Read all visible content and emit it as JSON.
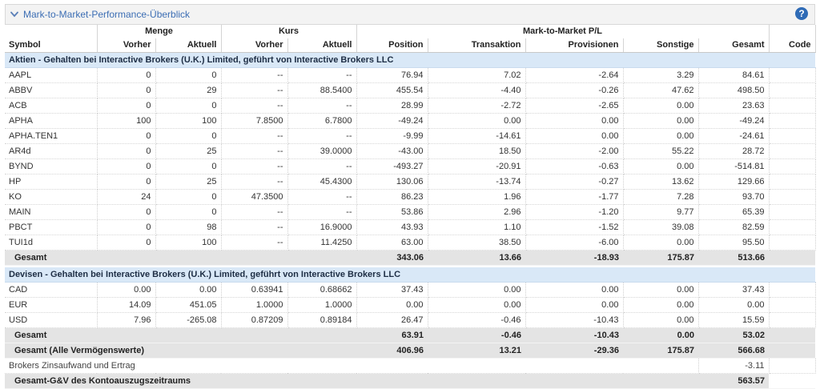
{
  "panel": {
    "title": "Mark-to-Market-Performance-Überblick",
    "help_glyph": "?"
  },
  "header": {
    "groups": {
      "menge": "Menge",
      "kurs": "Kurs",
      "mtm": "Mark-to-Market P/L"
    },
    "cols": [
      "Symbol",
      "Vorher",
      "Aktuell",
      "Vorher",
      "Aktuell",
      "Position",
      "Transaktion",
      "Provisionen",
      "Sonstige",
      "Gesamt",
      "Code"
    ]
  },
  "sections": {
    "stocks": {
      "title": "Aktien - Gehalten bei Interactive Brokers (U.K.) Limited, geführt von Interactive Brokers LLC",
      "rows": [
        [
          "AAPL",
          "0",
          "0",
          "--",
          "--",
          "76.94",
          "7.02",
          "-2.64",
          "3.29",
          "84.61",
          ""
        ],
        [
          "ABBV",
          "0",
          "29",
          "--",
          "88.5400",
          "455.54",
          "-4.40",
          "-0.26",
          "47.62",
          "498.50",
          ""
        ],
        [
          "ACB",
          "0",
          "0",
          "--",
          "--",
          "28.99",
          "-2.72",
          "-2.65",
          "0.00",
          "23.63",
          ""
        ],
        [
          "APHA",
          "100",
          "100",
          "7.8500",
          "6.7800",
          "-49.24",
          "0.00",
          "0.00",
          "0.00",
          "-49.24",
          ""
        ],
        [
          "APHA.TEN1",
          "0",
          "0",
          "--",
          "--",
          "-9.99",
          "-14.61",
          "0.00",
          "0.00",
          "-24.61",
          ""
        ],
        [
          "AR4d",
          "0",
          "25",
          "--",
          "39.0000",
          "-43.00",
          "18.50",
          "-2.00",
          "55.22",
          "28.72",
          ""
        ],
        [
          "BYND",
          "0",
          "0",
          "--",
          "--",
          "-493.27",
          "-20.91",
          "-0.63",
          "0.00",
          "-514.81",
          ""
        ],
        [
          "HP",
          "0",
          "25",
          "--",
          "45.4300",
          "130.06",
          "-13.74",
          "-0.27",
          "13.62",
          "129.66",
          ""
        ],
        [
          "KO",
          "24",
          "0",
          "47.3500",
          "--",
          "86.23",
          "1.96",
          "-1.77",
          "7.28",
          "93.70",
          ""
        ],
        [
          "MAIN",
          "0",
          "0",
          "--",
          "--",
          "53.86",
          "2.96",
          "-1.20",
          "9.77",
          "65.39",
          ""
        ],
        [
          "PBCT",
          "0",
          "98",
          "--",
          "16.9000",
          "43.93",
          "1.10",
          "-1.52",
          "39.08",
          "82.59",
          ""
        ],
        [
          "TUI1d",
          "0",
          "100",
          "--",
          "11.4250",
          "63.00",
          "38.50",
          "-6.00",
          "0.00",
          "95.50",
          ""
        ]
      ],
      "total": {
        "label": "Gesamt",
        "position": "343.06",
        "transaktion": "13.66",
        "provisionen": "-18.93",
        "sonstige": "175.87",
        "gesamt": "513.66"
      }
    },
    "fx": {
      "title": "Devisen - Gehalten bei Interactive Brokers (U.K.) Limited, geführt von Interactive Brokers LLC",
      "rows": [
        [
          "CAD",
          "0.00",
          "0.00",
          "0.63941",
          "0.68662",
          "37.43",
          "0.00",
          "0.00",
          "0.00",
          "37.43",
          ""
        ],
        [
          "EUR",
          "14.09",
          "451.05",
          "1.0000",
          "1.0000",
          "0.00",
          "0.00",
          "0.00",
          "0.00",
          "0.00",
          ""
        ],
        [
          "USD",
          "7.96",
          "-265.08",
          "0.87209",
          "0.89184",
          "26.47",
          "-0.46",
          "-10.43",
          "0.00",
          "15.59",
          ""
        ]
      ],
      "total": {
        "label": "Gesamt",
        "position": "63.91",
        "transaktion": "-0.46",
        "provisionen": "-10.43",
        "sonstige": "0.00",
        "gesamt": "53.02"
      }
    }
  },
  "grand_total": {
    "label": "Gesamt (Alle Vermögenswerte)",
    "position": "406.96",
    "transaktion": "13.21",
    "provisionen": "-29.36",
    "sonstige": "175.87",
    "gesamt": "566.68"
  },
  "interest": {
    "label": "Brokers Zinsaufwand und Ertrag",
    "gesamt": "-3.11"
  },
  "period_total": {
    "label": "Gesamt-G&V des Kontoauszugszeitraums",
    "gesamt": "563.57"
  },
  "colors": {
    "accent": "#3c6eb4",
    "section_bg": "#d9e8f7",
    "total_bg": "#e4e4e4"
  }
}
